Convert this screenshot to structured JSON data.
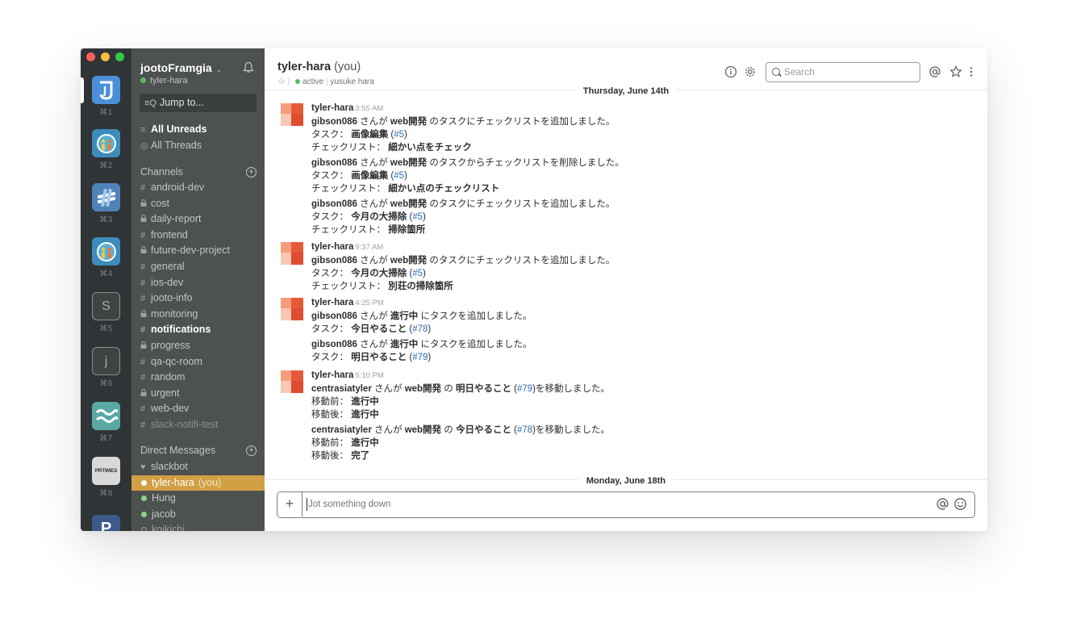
{
  "colors": {
    "accent": "#d1a045",
    "sidebar": "#4d5250",
    "teams_bar": "#313437",
    "online": "#5cb85c",
    "link": "#2b6cb0"
  },
  "teams": [
    {
      "key": "⌘1",
      "letter": "J",
      "bg": "#4a90d9",
      "icon": "jooto-logo-icon"
    },
    {
      "key": "⌘2",
      "letter": "",
      "bg": "#3c8dbc",
      "icon": "team-people-icon"
    },
    {
      "key": "⌘3",
      "letter": "",
      "bg": "#4f83b8",
      "icon": "team-ribbon-icon"
    },
    {
      "key": "⌘4",
      "letter": "",
      "bg": "#3c8dbc",
      "icon": "team-people-icon"
    },
    {
      "key": "⌘5",
      "letter": "S",
      "bg": "#555a58",
      "icon": "team-letter-s-icon"
    },
    {
      "key": "⌘6",
      "letter": "j",
      "bg": "#555a58",
      "icon": "team-letter-j-icon"
    },
    {
      "key": "⌘7",
      "letter": "",
      "bg": "#5aa9a3",
      "icon": "team-wave-icon"
    },
    {
      "key": "⌘8",
      "letter": "PRTIMES",
      "bg": "#d9d9d9",
      "icon": "prtimes-logo-icon"
    },
    {
      "key": "",
      "letter": "P",
      "bg": "#3d5a8a",
      "icon": "team-letter-p-icon"
    }
  ],
  "workspace": {
    "name": "jootoFramgia",
    "caret": "⌄",
    "user": "tyler-hara"
  },
  "jump_to": "Jump to...",
  "nav": {
    "all_unreads": "All Unreads",
    "all_threads": "All Threads"
  },
  "channels_title": "Channels",
  "channels": [
    {
      "name": "android-dev",
      "prefix": "#",
      "bold": false,
      "muted": false
    },
    {
      "name": "cost",
      "prefix": "🔒",
      "bold": false,
      "muted": false
    },
    {
      "name": "daily-report",
      "prefix": "🔒",
      "bold": false,
      "muted": false
    },
    {
      "name": "frontend",
      "prefix": "#",
      "bold": false,
      "muted": false
    },
    {
      "name": "future-dev-project",
      "prefix": "🔒",
      "bold": false,
      "muted": false
    },
    {
      "name": "general",
      "prefix": "#",
      "bold": false,
      "muted": false
    },
    {
      "name": "ios-dev",
      "prefix": "#",
      "bold": false,
      "muted": false
    },
    {
      "name": "jooto-info",
      "prefix": "#",
      "bold": false,
      "muted": false
    },
    {
      "name": "monitoring",
      "prefix": "🔒",
      "bold": false,
      "muted": false
    },
    {
      "name": "notifications",
      "prefix": "#",
      "bold": true,
      "muted": false
    },
    {
      "name": "progress",
      "prefix": "🔒",
      "bold": false,
      "muted": false
    },
    {
      "name": "qa-qc-room",
      "prefix": "#",
      "bold": false,
      "muted": false
    },
    {
      "name": "random",
      "prefix": "#",
      "bold": false,
      "muted": false
    },
    {
      "name": "urgent",
      "prefix": "🔒",
      "bold": false,
      "muted": false
    },
    {
      "name": "web-dev",
      "prefix": "#",
      "bold": false,
      "muted": false
    },
    {
      "name": "slack-notifi-test",
      "prefix": "#",
      "bold": false,
      "muted": true
    }
  ],
  "dm_title": "Direct Messages",
  "dms": [
    {
      "name": "slackbot",
      "suffix": "",
      "status": "heart"
    },
    {
      "name": "tyler-hara",
      "suffix": "(you)",
      "status": "online",
      "active": true
    },
    {
      "name": "Hung",
      "suffix": "",
      "status": "online"
    },
    {
      "name": "jacob",
      "suffix": "",
      "status": "online"
    },
    {
      "name": "koikichi",
      "suffix": "",
      "status": "offline"
    }
  ],
  "header": {
    "channel": "tyler-hara",
    "you": "(you)",
    "star": "☆",
    "status": "active",
    "realname": "yusuke hara",
    "search_placeholder": "Search"
  },
  "dividers": {
    "first": "Thursday, June 14th",
    "second": "Monday, June 18th"
  },
  "messages": [
    {
      "user": "tyler-hara",
      "time": "3:55 AM",
      "blocks": [
        {
          "actor": "gibson086",
          "t1": " さんが ",
          "b1": "web開発",
          "t2": " のタスクにチェックリストを追加しました。",
          "task_label": "タスク：",
          "task": "画像編集",
          "task_link": "#5",
          "extra_label": "チェックリスト：",
          "extra": "細かい点をチェック"
        },
        {
          "actor": "gibson086",
          "t1": " さんが ",
          "b1": "web開発",
          "t2": " のタスクからチェックリストを削除しました。",
          "task_label": "タスク：",
          "task": "画像編集",
          "task_link": "#5",
          "extra_label": "チェックリスト：",
          "extra": "細かい点のチェックリスト"
        },
        {
          "actor": "gibson086",
          "t1": " さんが ",
          "b1": "web開発",
          "t2": " のタスクにチェックリストを追加しました。",
          "task_label": "タスク：",
          "task": "今月の大掃除",
          "task_link": "#5",
          "extra_label": "チェックリスト：",
          "extra": "掃除箇所"
        }
      ]
    },
    {
      "user": "tyler-hara",
      "time": "9:37 AM",
      "blocks": [
        {
          "actor": "gibson086",
          "t1": " さんが ",
          "b1": "web開発",
          "t2": " のタスクにチェックリストを追加しました。",
          "task_label": "タスク：",
          "task": "今月の大掃除",
          "task_link": "#5",
          "extra_label": "チェックリスト：",
          "extra": "別荘の掃除箇所"
        }
      ]
    },
    {
      "user": "tyler-hara",
      "time": "4:25 PM",
      "blocks": [
        {
          "actor": "gibson086",
          "t1": " さんが ",
          "b1": "進行中",
          "t2": " にタスクを追加しました。",
          "task_label": "タスク：",
          "task": "今日やること",
          "task_link": "#78"
        },
        {
          "actor": "gibson086",
          "t1": " さんが ",
          "b1": "進行中",
          "t2": " にタスクを追加しました。",
          "task_label": "タスク：",
          "task": "明日やること",
          "task_link": "#79"
        }
      ]
    },
    {
      "user": "tyler-hara",
      "time": "5:10 PM",
      "moves": [
        {
          "actor": "centrasiatyler",
          "t1": " さんが ",
          "b1": "web開発",
          "t2": " の ",
          "b2": "明日やること",
          "link": "#79",
          "t3": "を移動しました。",
          "before_label": "移動前：",
          "before": "進行中",
          "after_label": "移動後：",
          "after": "進行中"
        },
        {
          "actor": "centrasiatyler",
          "t1": " さんが ",
          "b1": "web開発",
          "t2": " の ",
          "b2": "今日やること",
          "link": "#78",
          "t3": "を移動しました。",
          "before_label": "移動前：",
          "before": "進行中",
          "after_label": "移動後：",
          "after": "完了"
        }
      ]
    }
  ],
  "composer": {
    "plus": "+",
    "placeholder": "Jot something down"
  }
}
